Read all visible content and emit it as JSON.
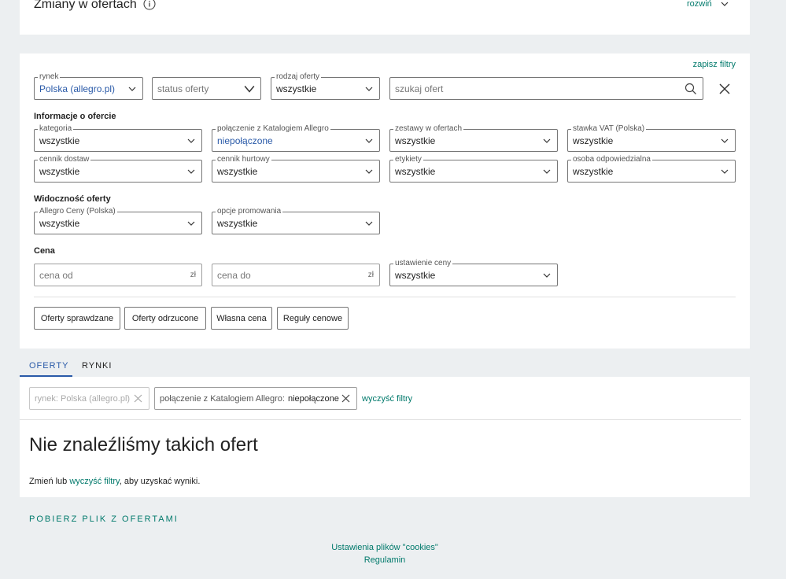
{
  "header": {
    "title": "Zmiany w ofertach",
    "expand_label": "rozwiń"
  },
  "filters": {
    "save_filters": "zapisz filtry",
    "market": {
      "legend": "rynek",
      "value": "Polska (allegro.pl)"
    },
    "status": {
      "value": "status oferty"
    },
    "offer_type": {
      "legend": "rodzaj oferty",
      "value": "wszystkie"
    },
    "search": {
      "placeholder": "szukaj ofert"
    },
    "info_section": "Informacje o ofercie",
    "category": {
      "legend": "kategoria",
      "value": "wszystkie"
    },
    "catalog": {
      "legend": "połączenie z Katalogiem Allegro",
      "value": "niepołączone"
    },
    "sets": {
      "legend": "zestawy w ofertach",
      "value": "wszystkie"
    },
    "vat": {
      "legend": "stawka VAT (Polska)",
      "value": "wszystkie"
    },
    "delivery": {
      "legend": "cennik dostaw",
      "value": "wszystkie"
    },
    "wholesale": {
      "legend": "cennik hurtowy",
      "value": "wszystkie"
    },
    "labels": {
      "legend": "etykiety",
      "value": "wszystkie"
    },
    "responsible": {
      "legend": "osoba odpowiedzialna",
      "value": "wszystkie"
    },
    "visibility_section": "Widoczność oferty",
    "allegro_prices": {
      "legend": "Allegro Ceny (Polska)",
      "value": "wszystkie"
    },
    "promo": {
      "legend": "opcje promowania",
      "value": "wszystkie"
    },
    "price_section": "Cena",
    "price_from": {
      "placeholder": "cena od",
      "unit": "zł"
    },
    "price_to": {
      "placeholder": "cena do",
      "unit": "zł"
    },
    "price_setting": {
      "legend": "ustawienie ceny",
      "value": "wszystkie"
    },
    "buttons": {
      "checked": "Oferty sprawdzane",
      "rejected": "Oferty odrzucone",
      "own_price": "Własna cena",
      "price_rules": "Reguły cenowe"
    }
  },
  "tabs": {
    "offers": "OFERTY",
    "markets": "RYNKI"
  },
  "active_filters": {
    "market_chip": "rynek: Polska (allegro.pl)",
    "catalog_chip_key": "połączenie z Katalogiem Allegro:",
    "catalog_chip_value": "niepołączone",
    "clear": "wyczyść filtry"
  },
  "results": {
    "empty_title": "Nie znaleźliśmy takich ofert",
    "hint_before": "Zmień lub",
    "hint_link": "wyczyść filtry",
    "hint_after": ", aby uzyskać wyniki."
  },
  "download": "POBIERZ PLIK Z OFERTAMI",
  "footer": {
    "cookies": "Ustawienia plików \"cookies\"",
    "terms": "Regulamin"
  },
  "colors": {
    "accent": "#00796b",
    "link_blue": "#2a5aa8",
    "tab_active": "#2a5aa8"
  }
}
